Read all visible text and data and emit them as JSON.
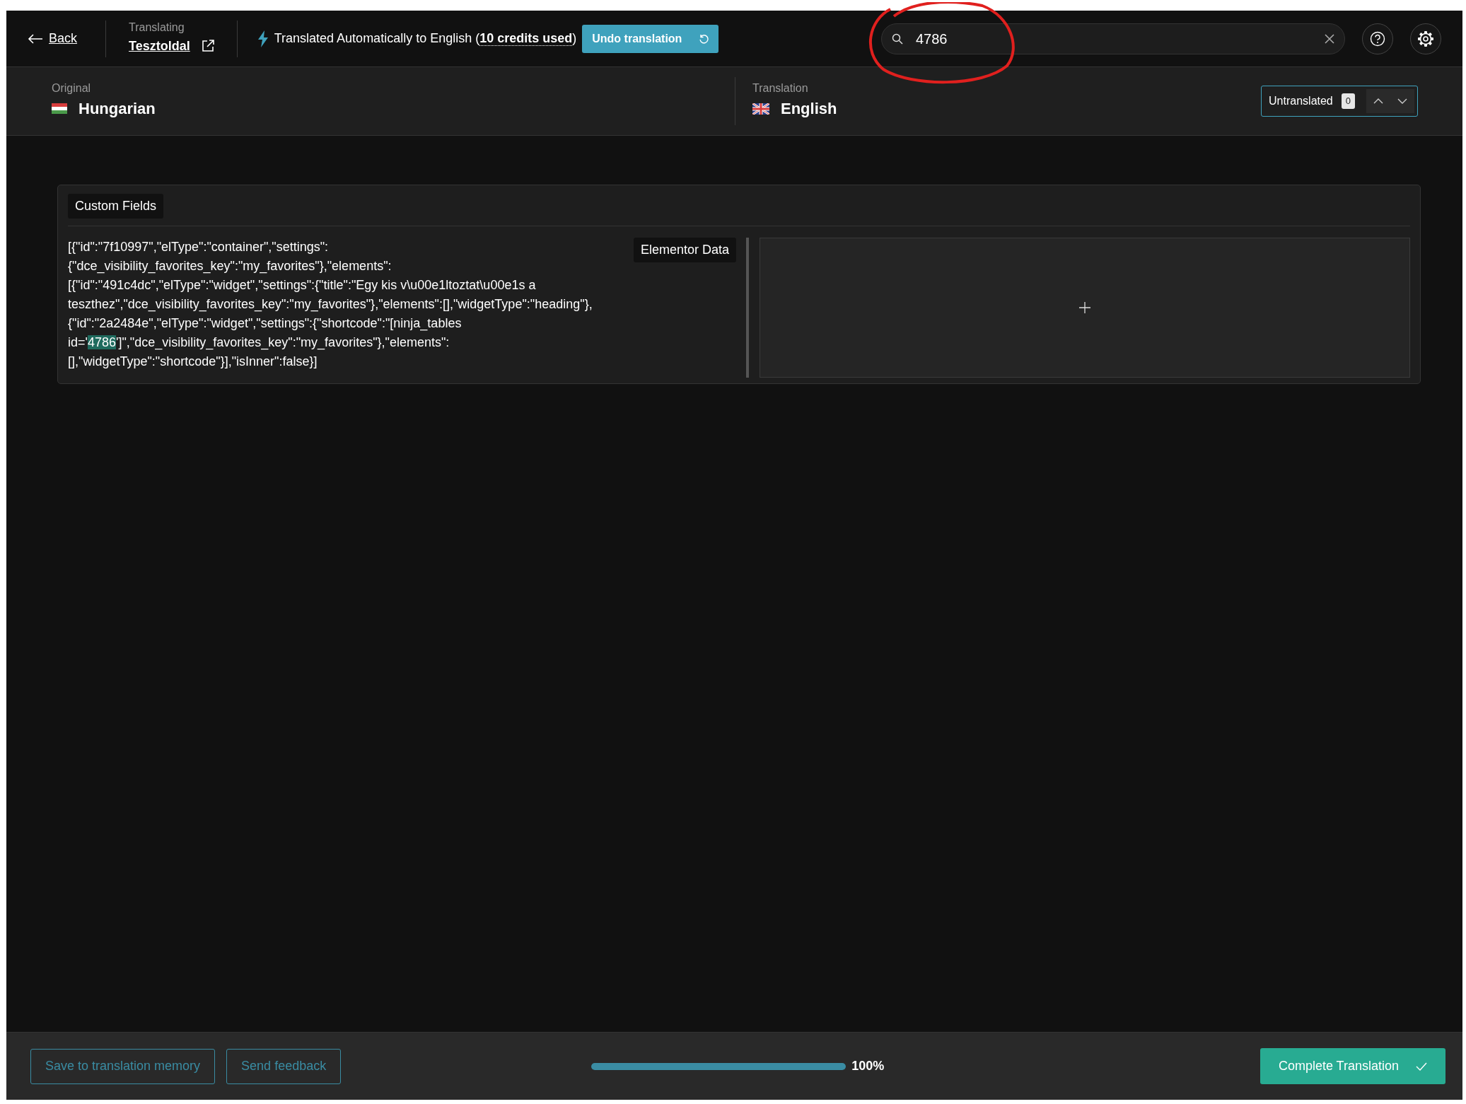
{
  "topbar": {
    "back": "Back",
    "translating": {
      "label": "Translating",
      "page": "Tesztoldal"
    },
    "status": {
      "before": "Translated Automatically to English (",
      "credits": "10 credits used",
      "after": ")"
    },
    "undo": "Undo translation",
    "search": {
      "value": "4786"
    }
  },
  "header": {
    "original": {
      "label": "Original",
      "language": "Hungarian"
    },
    "translation": {
      "label": "Translation",
      "language": "English"
    },
    "untranslated": {
      "label": "Untranslated",
      "count": "0"
    }
  },
  "section": {
    "title": "Custom Fields",
    "field_label": "Elementor Data",
    "source": {
      "before": "[{\"id\":\"7f10997\",\"elType\":\"container\",\"settings\":{\"dce_visibility_favorites_key\":\"my_favorites\"},\"elements\":[{\"id\":\"491c4dc\",\"elType\":\"widget\",\"settings\":{\"title\":\"Egy kis v\\u00e1ltoztat\\u00e1s a teszthez\",\"dce_visibility_favorites_key\":\"my_favorites\"},\"elements\":[],\"widgetType\":\"heading\"},{\"id\":\"2a2484e\",\"elType\":\"widget\",\"settings\":{\"shortcode\":\"[ninja_tables id='",
      "match": "4786",
      "after": "']\",\"dce_visibility_favorites_key\":\"my_favorites\"},\"elements\":[],\"widgetType\":\"shortcode\"}],\"isInner\":false}]"
    }
  },
  "footer": {
    "buttons": [
      "Save to translation memory",
      "Send feedback"
    ],
    "progress": {
      "level": 1,
      "reading": "100%"
    },
    "complete": "Complete Translation"
  }
}
